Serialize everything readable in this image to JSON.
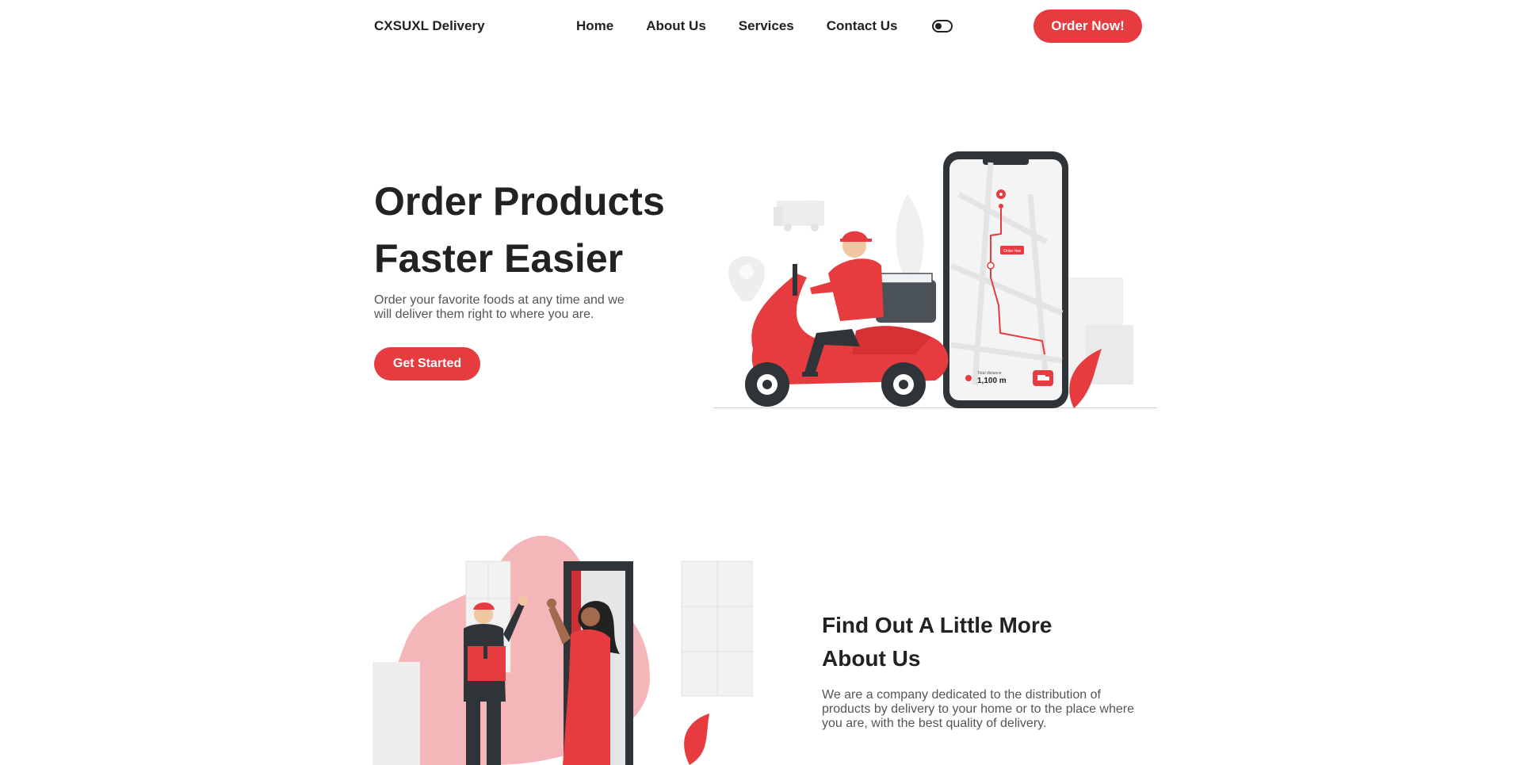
{
  "nav": {
    "brand": "CXSUXL Delivery",
    "links": [
      "Home",
      "About Us",
      "Services",
      "Contact Us"
    ],
    "toggle_icon": "theme-toggle-icon",
    "order_label": "Order Now!"
  },
  "hero": {
    "title_line1": "Order Products",
    "title_line2": "Faster Easier",
    "description": "Order your favorite foods at any time and we will deliver them right to where you are.",
    "cta_label": "Get Started",
    "phone": {
      "distance_label": "Total distance",
      "distance_value": "1,100 m",
      "map_tag": "Order few"
    }
  },
  "about": {
    "title_line1": "Find Out A Little More",
    "title_line2": "About Us",
    "description": "We are a company dedicated to the distribution of products by delivery to your home or to the place where you are, with the best quality of delivery."
  },
  "colors": {
    "accent": "#e63c3f",
    "text": "#222222",
    "muted": "#555555",
    "dark": "#2f3438"
  }
}
